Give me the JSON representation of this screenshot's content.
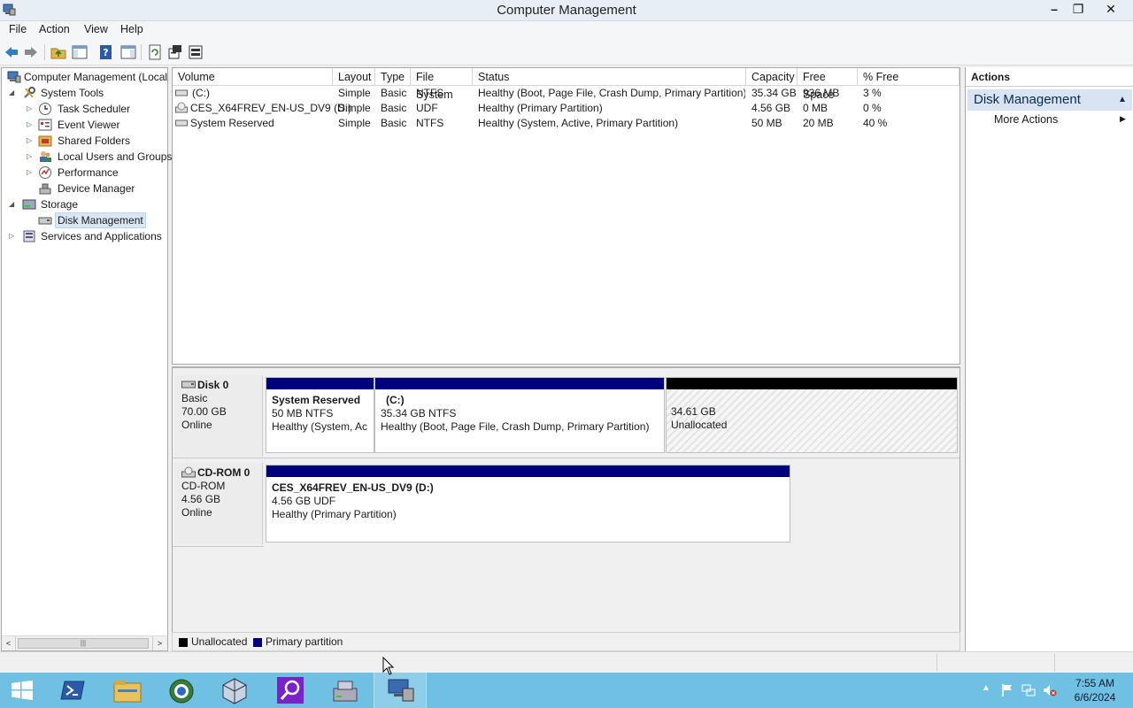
{
  "window": {
    "title": "Computer Management",
    "controls": {
      "minimize": "–",
      "restore": "❐",
      "close": "✕"
    }
  },
  "menu": [
    "File",
    "Action",
    "View",
    "Help"
  ],
  "tree": {
    "root": "Computer Management (Local",
    "items": [
      {
        "label": "System Tools",
        "level": 1,
        "expander": "◢",
        "icon": "tools-icon"
      },
      {
        "label": "Task Scheduler",
        "level": 2,
        "expander": "▷",
        "icon": "clock-icon"
      },
      {
        "label": "Event Viewer",
        "level": 2,
        "expander": "▷",
        "icon": "event-viewer-icon"
      },
      {
        "label": "Shared Folders",
        "level": 2,
        "expander": "▷",
        "icon": "shared-folder-icon"
      },
      {
        "label": "Local Users and Groups",
        "level": 2,
        "expander": "▷",
        "icon": "users-icon"
      },
      {
        "label": "Performance",
        "level": 2,
        "expander": "▷",
        "icon": "performance-icon"
      },
      {
        "label": "Device Manager",
        "level": 2,
        "expander": "",
        "icon": "device-manager-icon"
      },
      {
        "label": "Storage",
        "level": 1,
        "expander": "◢",
        "icon": "storage-icon"
      },
      {
        "label": "Disk Management",
        "level": 2,
        "expander": "",
        "icon": "disk-icon",
        "selected": true
      },
      {
        "label": "Services and Applications",
        "level": 1,
        "expander": "▷",
        "icon": "services-icon"
      }
    ]
  },
  "volumes": {
    "headers": [
      "Volume",
      "Layout",
      "Type",
      "File System",
      "Status",
      "Capacity",
      "Free Space",
      "% Free"
    ],
    "rows": [
      [
        "(C:)",
        "Simple",
        "Basic",
        "NTFS",
        "Healthy (Boot, Page File, Crash Dump, Primary Partition)",
        "35.34 GB",
        "936 MB",
        "3 %"
      ],
      [
        "CES_X64FREV_EN-US_DV9 (D:)",
        "Simple",
        "Basic",
        "UDF",
        "Healthy (Primary Partition)",
        "4.56 GB",
        "0 MB",
        "0 %"
      ],
      [
        "System Reserved",
        "Simple",
        "Basic",
        "NTFS",
        "Healthy (System, Active, Primary Partition)",
        "50 MB",
        "20 MB",
        "40 %"
      ]
    ]
  },
  "disks": [
    {
      "name": "Disk 0",
      "type": "Basic",
      "size": "70.00 GB",
      "state": "Online",
      "partitions": [
        {
          "title": "System Reserved",
          "size": "50 MB NTFS",
          "status": "Healthy (System, Ac"
        },
        {
          "title": "(C:)",
          "size": "35.34 GB NTFS",
          "status": "Healthy (Boot, Page File, Crash Dump, Primary Partition)"
        },
        {
          "title": "",
          "size": "34.61 GB",
          "status": "Unallocated"
        }
      ]
    },
    {
      "name": "CD-ROM 0",
      "type": "CD-ROM",
      "size": "4.56 GB",
      "state": "Online",
      "partitions": [
        {
          "title": "CES_X64FREV_EN-US_DV9  (D:)",
          "size": "4.56 GB UDF",
          "status": "Healthy (Primary Partition)"
        }
      ]
    }
  ],
  "legend": [
    {
      "label": "Unallocated",
      "color": "#000000"
    },
    {
      "label": "Primary partition",
      "color": "#00007f"
    }
  ],
  "actions": {
    "header": "Actions",
    "section": "Disk Management",
    "items": [
      "More Actions"
    ]
  },
  "taskbar": {
    "apps": [
      "start-icon",
      "powershell-icon",
      "file-explorer-icon",
      "browser-icon",
      "virtualbox-icon",
      "search-app-icon",
      "server-manager-icon",
      "computer-management-icon"
    ],
    "clock_time": "7:55 AM",
    "clock_date": "6/6/2024"
  },
  "colors": {
    "primary_partition": "#00007f",
    "unallocated": "#000000",
    "taskbar": "#6fc0e3"
  }
}
